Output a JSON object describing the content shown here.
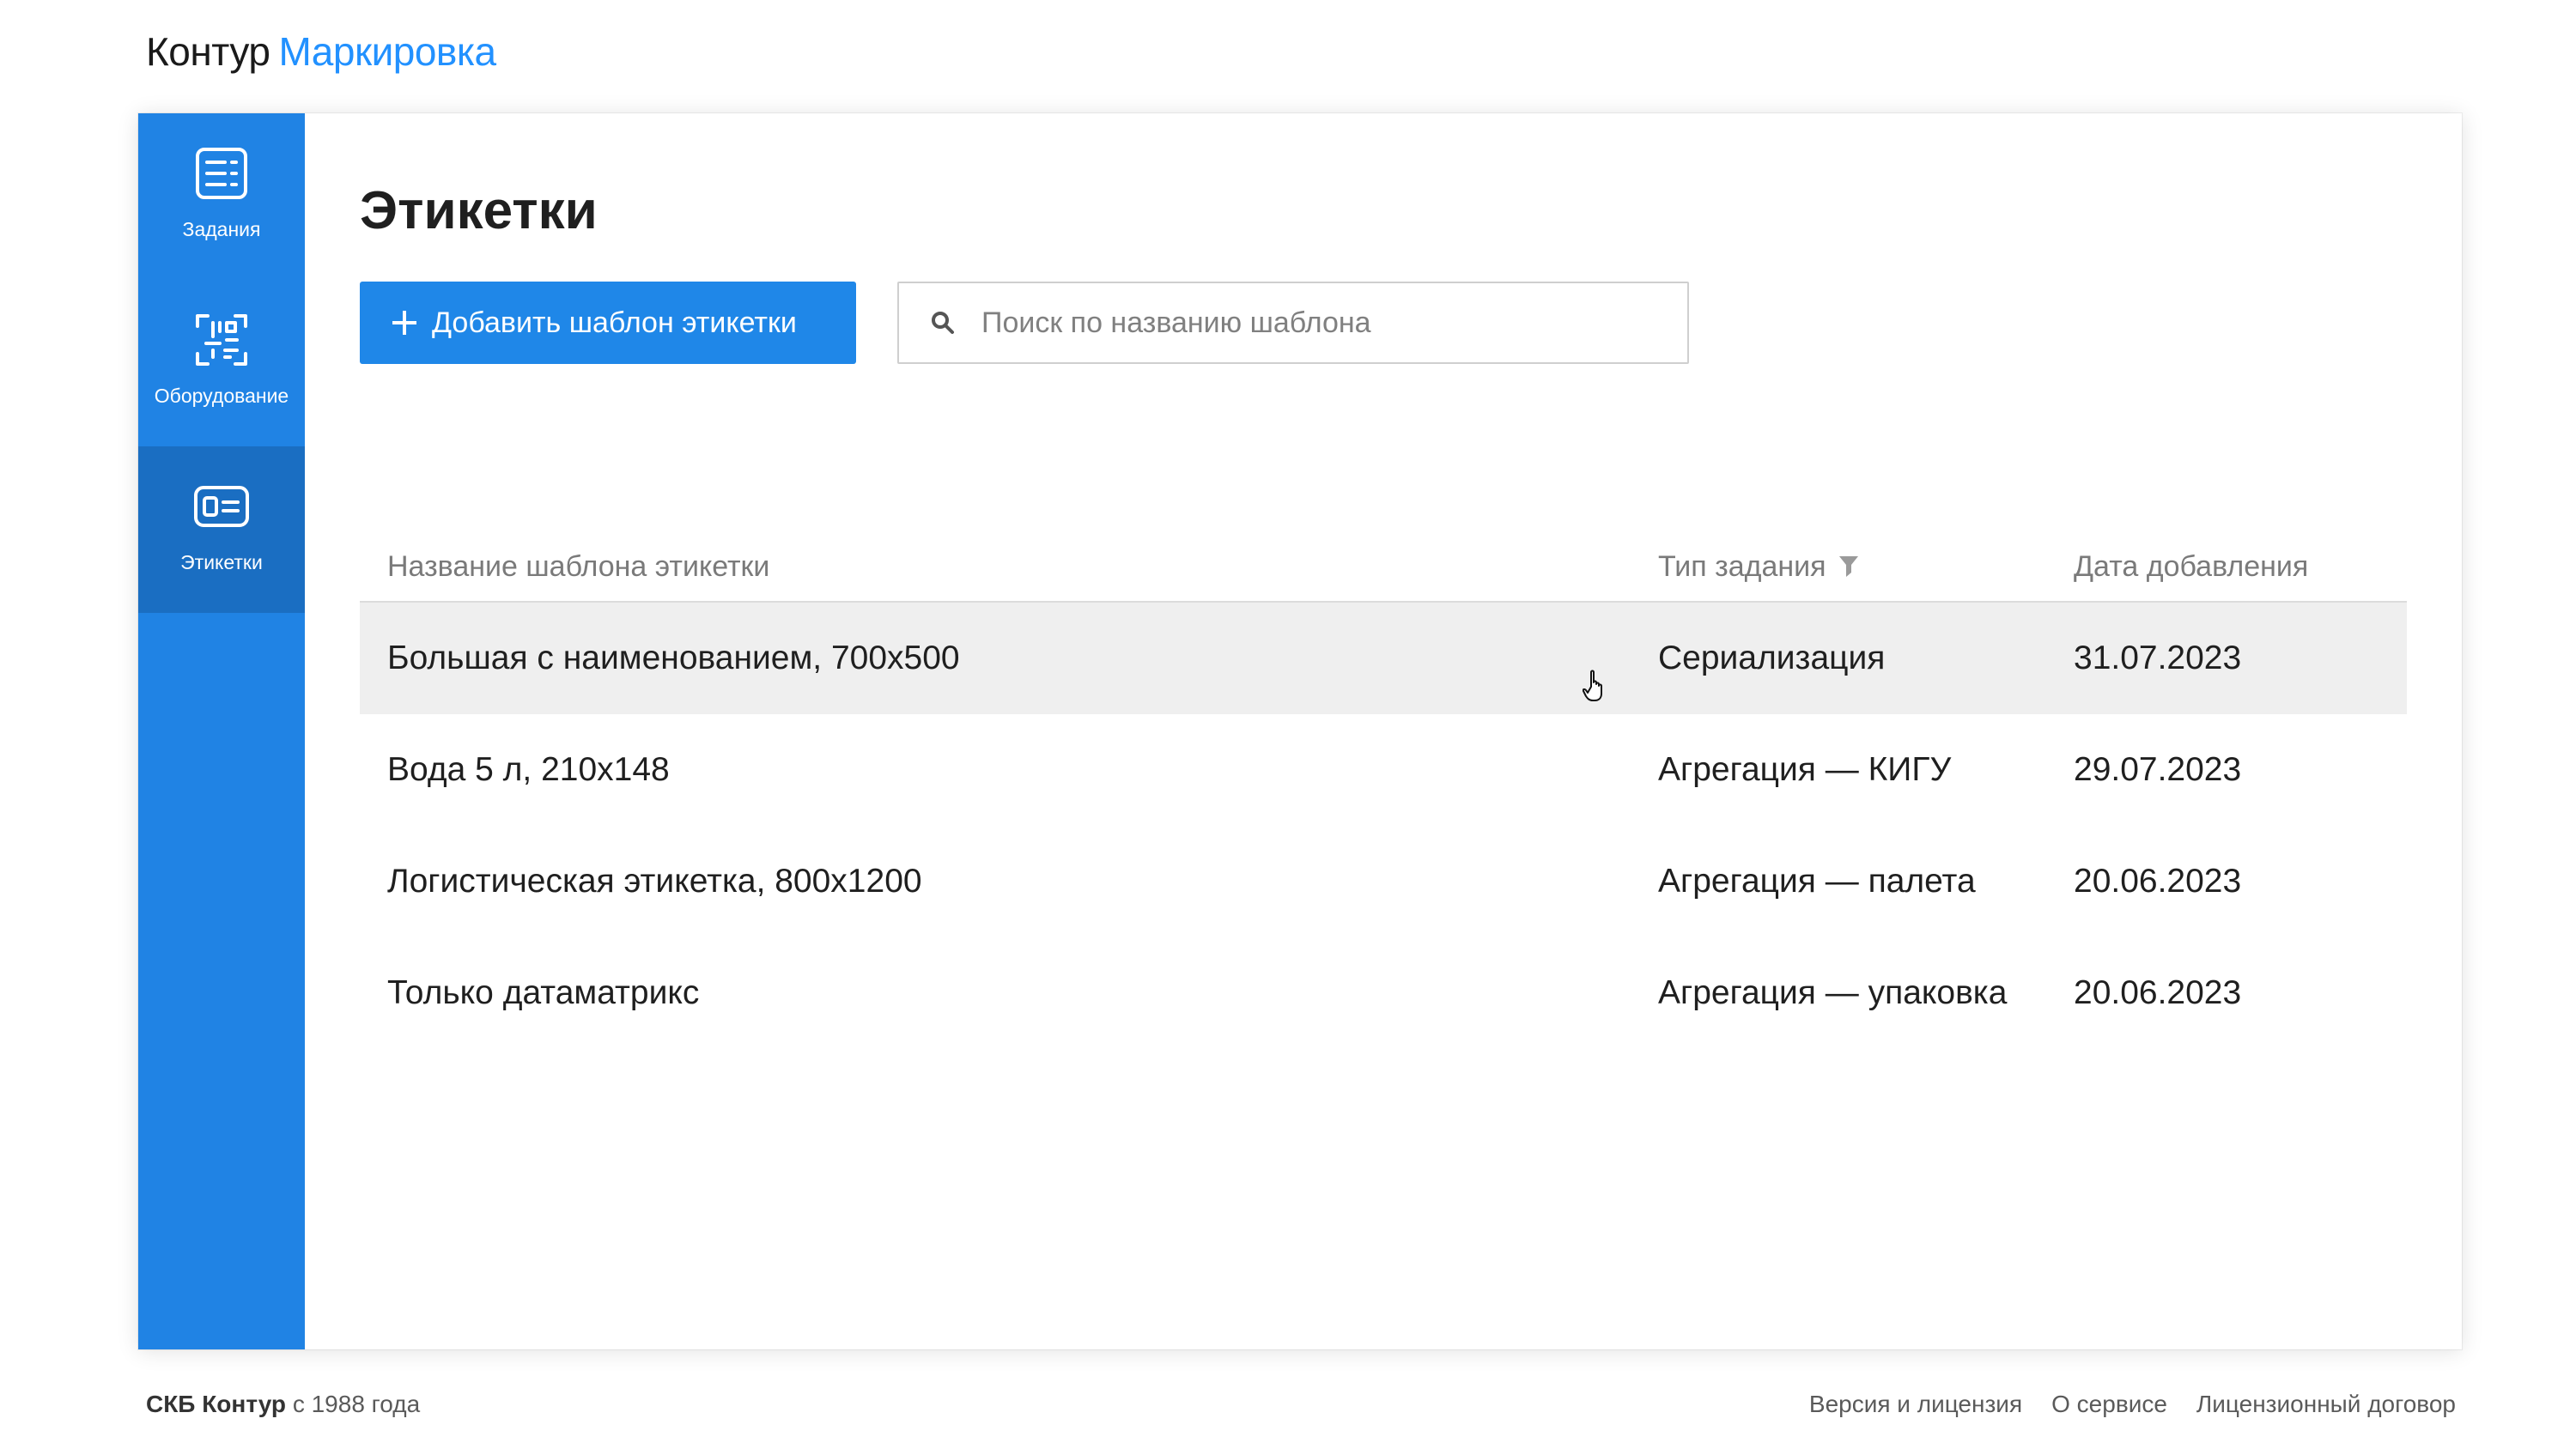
{
  "header": {
    "brand": "Контур",
    "product": "Маркировка"
  },
  "sidebar": {
    "items": [
      {
        "label": "Задания"
      },
      {
        "label": "Оборудование"
      },
      {
        "label": "Этикетки"
      }
    ],
    "active": "Этикетки"
  },
  "main": {
    "title": "Этикетки",
    "add_button": "Добавить шаблон этикетки",
    "search_placeholder": "Поиск по названию шаблона",
    "search_value": ""
  },
  "table": {
    "columns": [
      "Название шаблона этикетки",
      "Тип задания",
      "Дата добавления"
    ],
    "rows": [
      [
        "Большая с наименованием, 700x500",
        "Сериализация",
        "31.07.2023"
      ],
      [
        "Вода 5 л, 210x148",
        "Агрегация — КИГУ",
        "29.07.2023"
      ],
      [
        "Логистическая этикетка, 800x1200",
        "Агрегация — палета",
        "20.06.2023"
      ],
      [
        "Только датаматрикс",
        "Агрегация — упаковка",
        "20.06.2023"
      ]
    ]
  },
  "footer": {
    "company": "СКБ Контур",
    "since": "с 1988 года",
    "links": [
      "Версия и лицензия",
      "О сервисе",
      "Лицензионный договор"
    ]
  },
  "colors": {
    "accent": "#1f87e8",
    "sidebar": "#2083e4",
    "sidebar_active": "#1a6ec2",
    "brand_product": "#2291ff",
    "row_hover": "#efefef"
  },
  "icons": [
    "tasks-icon",
    "equipment-icon",
    "labels-icon",
    "plus-icon",
    "search-icon",
    "filter-icon",
    "hand-cursor-icon"
  ]
}
